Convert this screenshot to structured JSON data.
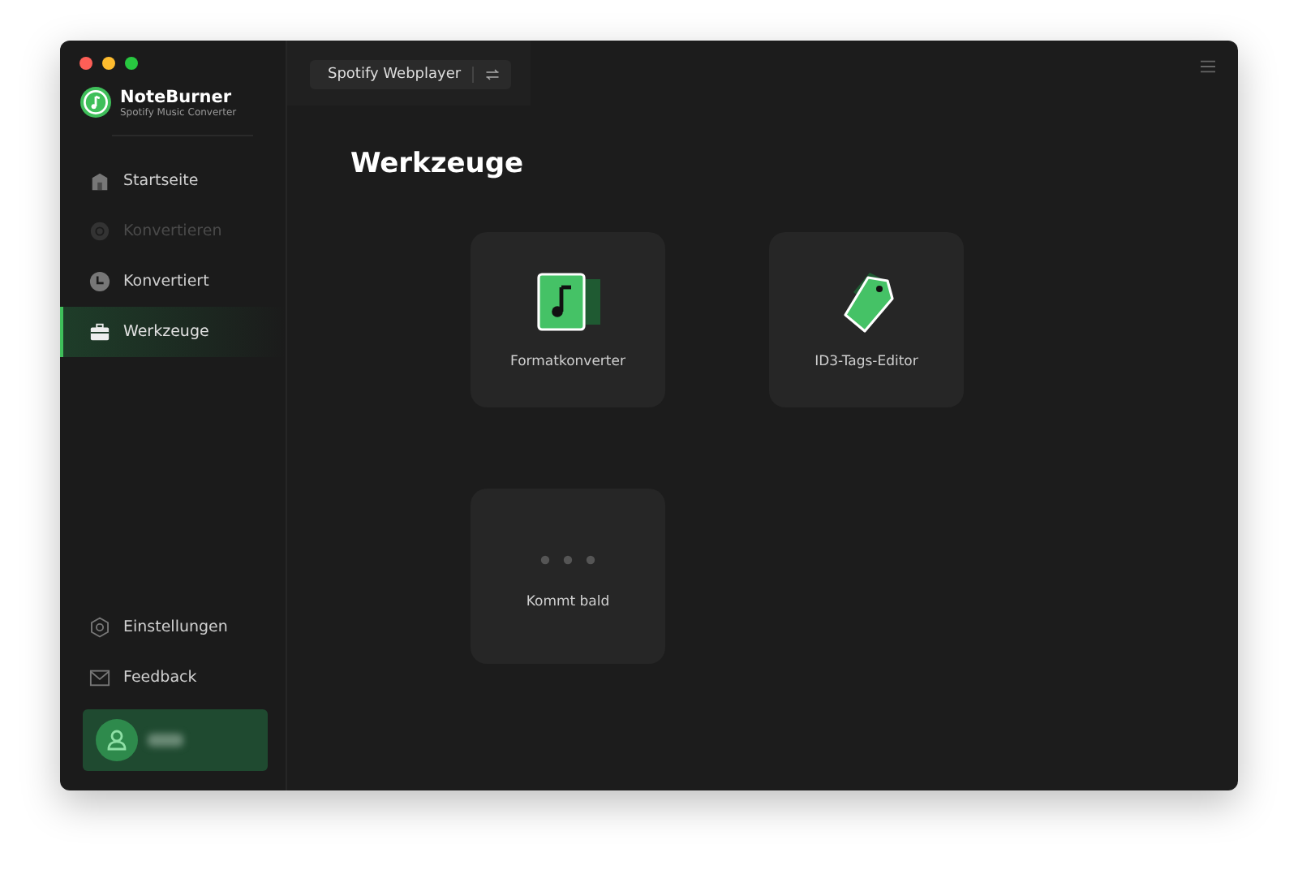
{
  "app": {
    "name": "NoteBurner",
    "subtitle": "Spotify Music Converter"
  },
  "nav": [
    {
      "label": "Startseite",
      "kind": "home",
      "selected": false,
      "disabled": false
    },
    {
      "label": "Konvertieren",
      "kind": "convert",
      "selected": false,
      "disabled": true
    },
    {
      "label": "Konvertiert",
      "kind": "clock",
      "selected": false,
      "disabled": false
    },
    {
      "label": "Werkzeuge",
      "kind": "toolbox",
      "selected": true,
      "disabled": false
    }
  ],
  "bottom_nav": [
    {
      "label": "Einstellungen",
      "kind": "settings"
    },
    {
      "label": "Feedback",
      "kind": "mail"
    }
  ],
  "source_button": {
    "label": "Spotify Webplayer"
  },
  "page_title": "Werkzeuge",
  "tools": [
    {
      "label": "Formatkonverter",
      "kind": "format"
    },
    {
      "label": "ID3-Tags-Editor",
      "kind": "tags"
    },
    {
      "label": "Kommt bald",
      "kind": "soon"
    }
  ]
}
